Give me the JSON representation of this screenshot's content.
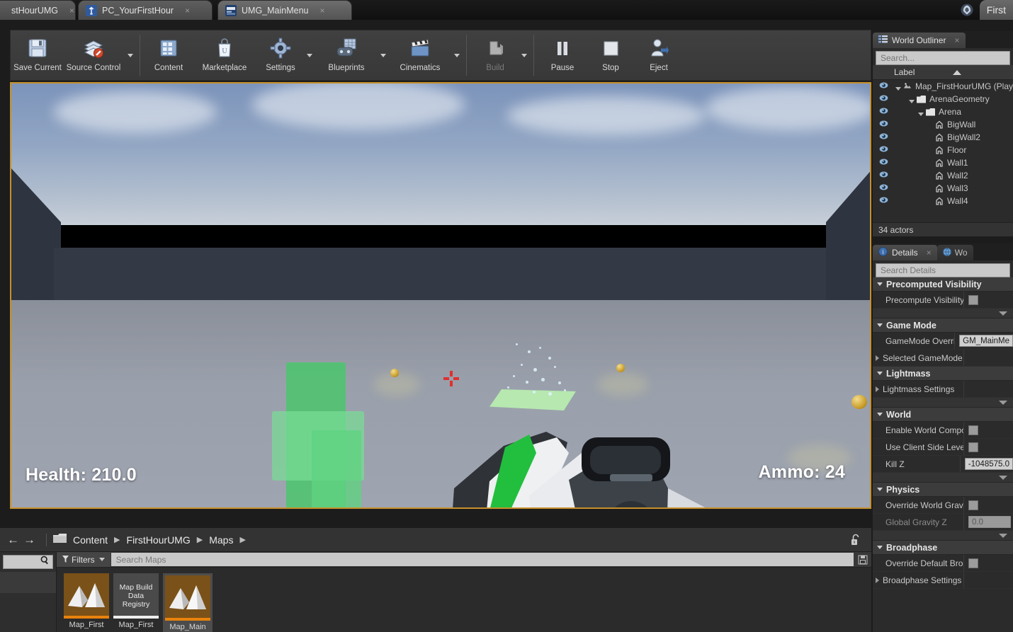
{
  "window": {
    "title": "First",
    "ue_logo_icon": "unreal-logo-icon"
  },
  "tabs": [
    {
      "label": "stHourUMG",
      "icon": "level-icon",
      "active": false,
      "close": "×"
    },
    {
      "label": "PC_YourFirstHour",
      "icon": "blueprint-icon",
      "active": false,
      "close": "×"
    },
    {
      "label": "UMG_MainMenu",
      "icon": "widget-blueprint-icon",
      "active": true,
      "close": "×"
    }
  ],
  "toolbar": {
    "groups": [
      {
        "buttons": [
          {
            "label": "Save Current",
            "icon": "floppy-disk-icon",
            "arrow": false,
            "disabled": false
          },
          {
            "label": "Source Control",
            "icon": "source-control-icon",
            "arrow": true,
            "disabled": false
          }
        ]
      },
      {
        "buttons": [
          {
            "label": "Content",
            "icon": "content-browser-icon",
            "arrow": false,
            "disabled": false
          },
          {
            "label": "Marketplace",
            "icon": "marketplace-bag-icon",
            "arrow": false,
            "disabled": false
          },
          {
            "label": "Settings",
            "icon": "gear-icon",
            "arrow": true,
            "disabled": false
          },
          {
            "label": "Blueprints",
            "icon": "blueprints-icon",
            "arrow": true,
            "disabled": false
          },
          {
            "label": "Cinematics",
            "icon": "clapperboard-icon",
            "arrow": true,
            "disabled": false
          }
        ]
      },
      {
        "buttons": [
          {
            "label": "Build",
            "icon": "build-cube-icon",
            "arrow": true,
            "disabled": true
          }
        ]
      },
      {
        "buttons": [
          {
            "label": "Pause",
            "icon": "pause-icon",
            "arrow": false,
            "disabled": false
          },
          {
            "label": "Stop",
            "icon": "stop-icon",
            "arrow": false,
            "disabled": false
          },
          {
            "label": "Eject",
            "icon": "eject-person-icon",
            "arrow": false,
            "disabled": false
          }
        ]
      }
    ]
  },
  "viewport": {
    "health_text": "Health: 210.0",
    "ammo_text": "Ammo: 24",
    "crosshair_icon": "crosshair-icon",
    "border_color": "#c8902a"
  },
  "world_outliner": {
    "tab_label": "World Outliner",
    "tab_icon": "outliner-icon",
    "close": "×",
    "search_placeholder": "Search...",
    "column_label": "Label",
    "sort_icon": "sort-ascending-icon",
    "rows": [
      {
        "label": "Map_FirstHourUMG (Play",
        "depth": 0,
        "type": "level",
        "expander": "open"
      },
      {
        "label": "ArenaGeometry",
        "depth": 1,
        "type": "folder",
        "expander": "open"
      },
      {
        "label": "Arena",
        "depth": 2,
        "type": "folder",
        "expander": "open"
      },
      {
        "label": "BigWall",
        "depth": 3,
        "type": "actor",
        "expander": "none"
      },
      {
        "label": "BigWall2",
        "depth": 3,
        "type": "actor",
        "expander": "none"
      },
      {
        "label": "Floor",
        "depth": 3,
        "type": "actor",
        "expander": "none"
      },
      {
        "label": "Wall1",
        "depth": 3,
        "type": "actor",
        "expander": "none"
      },
      {
        "label": "Wall2",
        "depth": 3,
        "type": "actor",
        "expander": "none"
      },
      {
        "label": "Wall3",
        "depth": 3,
        "type": "actor",
        "expander": "none"
      },
      {
        "label": "Wall4",
        "depth": 3,
        "type": "actor",
        "expander": "none"
      }
    ],
    "status": "34 actors"
  },
  "details": {
    "tab_label": "Details",
    "tab_icon": "details-info-icon",
    "close": "×",
    "second_tab_label": "Wo",
    "second_tab_icon": "world-settings-icon",
    "search_placeholder": "Search Details",
    "sections": [
      {
        "title": "Precomputed Visibility",
        "rows": [
          {
            "name": "Precompute Visibility",
            "control": "checkbox",
            "value": "",
            "dim": false,
            "arrow": false
          }
        ],
        "collapser": true
      },
      {
        "title": "Game Mode",
        "rows": [
          {
            "name": "GameMode Override",
            "control": "text",
            "value": "GM_MainMe",
            "dim": false,
            "arrow": false
          },
          {
            "name": "Selected GameMode",
            "control": "none",
            "value": "",
            "dim": false,
            "arrow": true
          }
        ],
        "collapser": false
      },
      {
        "title": "Lightmass",
        "rows": [
          {
            "name": "Lightmass Settings",
            "control": "none",
            "value": "",
            "dim": false,
            "arrow": true
          }
        ],
        "collapser": true
      },
      {
        "title": "World",
        "rows": [
          {
            "name": "Enable World Composi",
            "control": "checkbox",
            "value": "",
            "dim": false,
            "arrow": false
          },
          {
            "name": "Use Client Side Level ",
            "control": "checkbox",
            "value": "",
            "dim": false,
            "arrow": false
          },
          {
            "name": "Kill Z",
            "control": "text",
            "value": "-1048575.0",
            "dim": false,
            "arrow": false
          }
        ],
        "collapser": true
      },
      {
        "title": "Physics",
        "rows": [
          {
            "name": "Override World Gravity",
            "control": "checkbox",
            "value": "",
            "dim": false,
            "arrow": false
          },
          {
            "name": "Global Gravity Z",
            "control": "text",
            "value": "0.0",
            "dim": true,
            "arrow": false
          }
        ],
        "collapser": true
      },
      {
        "title": "Broadphase",
        "rows": [
          {
            "name": "Override Default Broad",
            "control": "checkbox",
            "value": "",
            "dim": false,
            "arrow": false
          },
          {
            "name": "Broadphase Settings",
            "control": "none",
            "value": "",
            "dim": false,
            "arrow": true
          }
        ],
        "collapser": false
      }
    ]
  },
  "content_browser": {
    "back_icon": "arrow-left-icon",
    "forward_icon": "arrow-right-icon",
    "folder_icon": "folder-icon",
    "lock_icon": "lock-open-icon",
    "save_icon": "save-search-icon",
    "search_icon": "search-icon",
    "breadcrumbs": [
      "Content",
      "FirstHourUMG",
      "Maps"
    ],
    "filters_label": "Filters",
    "filters_icon": "filter-funnel-icon",
    "search_placeholder": "Search Maps",
    "assets": [
      {
        "label": "Map_First",
        "thumb": "map-thumb",
        "bar": "orange",
        "selected": false
      },
      {
        "label": "Map_First",
        "thumb": "text-thumb",
        "thumb_text": "Map Build Data Registry",
        "bar": "white",
        "selected": false
      },
      {
        "label": "Map_Main",
        "thumb": "map-thumb",
        "bar": "orange",
        "selected": true
      }
    ]
  }
}
